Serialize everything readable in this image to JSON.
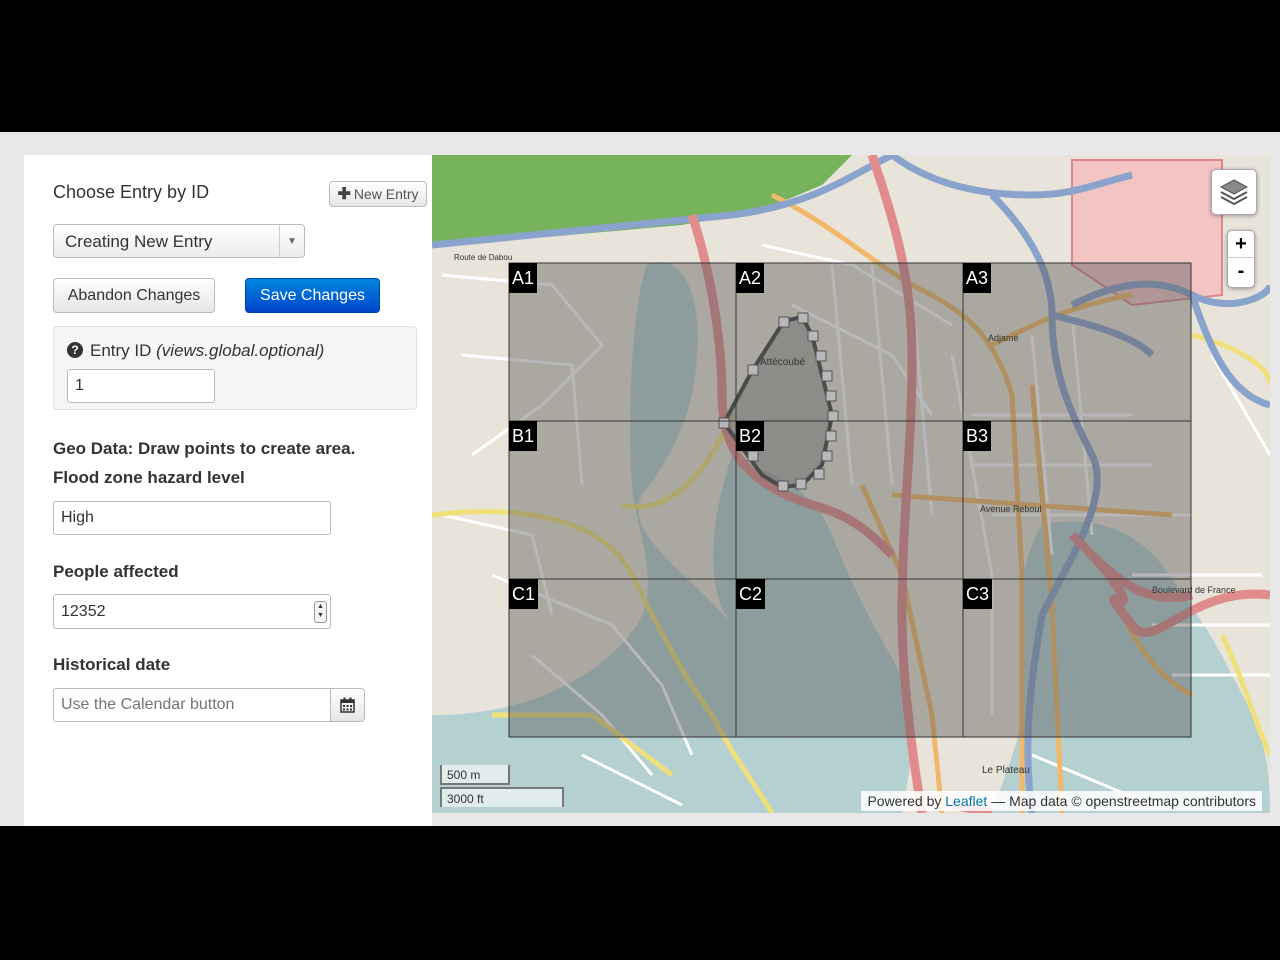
{
  "form": {
    "title": "Choose Entry by ID",
    "new_entry_label": "New Entry",
    "new_entry_icon": "plus-icon",
    "entry_select_value": "Creating New Entry",
    "abandon_label": "Abandon Changes",
    "save_label": "Save Changes",
    "entry_id_label": "Entry ID",
    "entry_id_hint": "(views.global.optional)",
    "entry_id_value": "1",
    "geo_label": "Geo Data: Draw points to create area.",
    "hazard_label": "Flood zone hazard level",
    "hazard_value": "High",
    "people_label": "People affected",
    "people_value": "12352",
    "date_label": "Historical date",
    "date_placeholder": "Use the Calendar button",
    "calendar_icon": "calendar-icon"
  },
  "map": {
    "grid_labels": [
      "A1",
      "A2",
      "A3",
      "B1",
      "B2",
      "B3",
      "C1",
      "C2",
      "C3"
    ],
    "zoom_in": "+",
    "zoom_out": "-",
    "layers_icon": "layers-icon",
    "scale_metric": "500 m",
    "scale_imperial": "3000 ft",
    "attribution_prefix": "Powered by",
    "attribution_link": "Leaflet",
    "attribution_suffix": "— Map data © openstreetmap contributors",
    "place_labels": [
      "Attécoubé",
      "Avenue Reboul",
      "Boulevard de France",
      "Le Plateau",
      "Adjamé",
      "Route de Dabou"
    ],
    "colors": {
      "primary_button": "#0055cc",
      "water": "#b5d0d0",
      "major_road": "#e08c8c",
      "park": "#76b35a"
    }
  }
}
